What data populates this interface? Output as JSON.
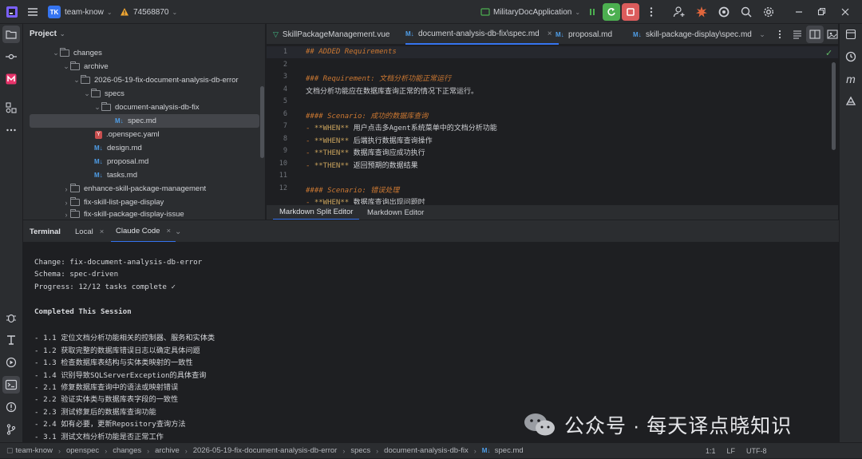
{
  "titlebar": {
    "project_initials": "TK",
    "project_name": "team-know",
    "warning_text": "74568870",
    "run_config": "MilitaryDocApplication"
  },
  "project_panel": {
    "title": "Project",
    "tree": [
      {
        "label": "changes",
        "type": "folder",
        "expanded": true
      },
      {
        "label": "archive",
        "type": "folder",
        "expanded": true
      },
      {
        "label": "2026-05-19-fix-document-analysis-db-error",
        "type": "folder",
        "expanded": true
      },
      {
        "label": "specs",
        "type": "folder",
        "expanded": true
      },
      {
        "label": "document-analysis-db-fix",
        "type": "folder",
        "expanded": true
      },
      {
        "label": "spec.md",
        "type": "md",
        "selected": true
      },
      {
        "label": ".openspec.yaml",
        "type": "yaml"
      },
      {
        "label": "design.md",
        "type": "md"
      },
      {
        "label": "proposal.md",
        "type": "md"
      },
      {
        "label": "tasks.md",
        "type": "md"
      },
      {
        "label": "enhance-skill-package-management",
        "type": "folder",
        "expanded": false
      },
      {
        "label": "fix-skill-list-page-display",
        "type": "folder",
        "expanded": false
      },
      {
        "label": "fix-skill-package-display-issue",
        "type": "folder",
        "expanded": false
      }
    ]
  },
  "editor_tabs": [
    {
      "label": "SkillPackageManagement.vue",
      "icon": "vue",
      "active": false
    },
    {
      "label": "document-analysis-db-fix\\spec.md",
      "icon": "md",
      "active": true
    },
    {
      "label": "proposal.md",
      "icon": "md",
      "active": false
    },
    {
      "label": "skill-package-display\\spec.md",
      "icon": "md",
      "active": false
    }
  ],
  "editor": {
    "line_numbers": [
      "1",
      "2",
      "3",
      "4",
      "5",
      "6",
      "7",
      "8",
      "9",
      "10",
      "11",
      "12"
    ],
    "lines": [
      {
        "text": "## ADDED Requirements",
        "kind": "h"
      },
      {
        "text": "",
        "kind": "plain"
      },
      {
        "text": "### Requirement: 文档分析功能正常运行",
        "kind": "h"
      },
      {
        "text": "文档分析功能应在数据库查询正常的情况下正常运行。",
        "kind": "plain"
      },
      {
        "text": "",
        "kind": "plain"
      },
      {
        "text": "#### Scenario: 成功的数据库查询",
        "kind": "h"
      },
      {
        "text": "- **WHEN** 用户点击多Agent系统菜单中的文档分析功能",
        "kind": "li"
      },
      {
        "text": "- **WHEN** 后端执行数据库查询操作",
        "kind": "li"
      },
      {
        "text": "- **THEN** 数据库查询应成功执行",
        "kind": "li"
      },
      {
        "text": "- **THEN** 返回预期的数据结果",
        "kind": "li"
      },
      {
        "text": "",
        "kind": "plain"
      },
      {
        "text": "#### Scenario: 错误处理",
        "kind": "h"
      },
      {
        "text": "- **WHEN** 数据库查询出现问题时",
        "kind": "li"
      }
    ],
    "bottom_tabs": [
      "Markdown Split Editor",
      "Markdown Editor"
    ]
  },
  "terminal": {
    "tabs": [
      "Terminal",
      "Local",
      "Claude Code"
    ],
    "lines": [
      "Change: fix-document-analysis-db-error",
      "Schema: spec-driven",
      "Progress: 12/12 tasks complete ✓",
      "",
      "Completed This Session",
      "",
      "- 1.1 定位文档分析功能相关的控制器、服务和实体类",
      "- 1.2 获取完整的数据库错误日志以确定具体问题",
      "- 1.3 检查数据库表结构与实体类映射的一致性",
      "- 1.4 识别导致SQLServerException的具体查询",
      "- 2.1 修复数据库查询中的语法或映射错误",
      "- 2.2 验证实体类与数据库表字段的一致性",
      "- 2.3 测试修复后的数据库查询功能",
      "- 2.4 如有必要，更新Repository查询方法",
      "- 3.1 测试文档分析功能是否正常工作"
    ]
  },
  "status": {
    "crumbs": [
      "team-know",
      "openspec",
      "changes",
      "archive",
      "2026-05-19-fix-document-analysis-db-error",
      "specs",
      "document-analysis-db-fix",
      "spec.md"
    ],
    "position": "1:1",
    "line_ending": "LF",
    "encoding": "UTF-8"
  },
  "watermark": "公众号 · 每天译点晓知识",
  "colors": {
    "accent": "#3574f0",
    "run": "#4caf50",
    "stop": "#db5c5c"
  }
}
